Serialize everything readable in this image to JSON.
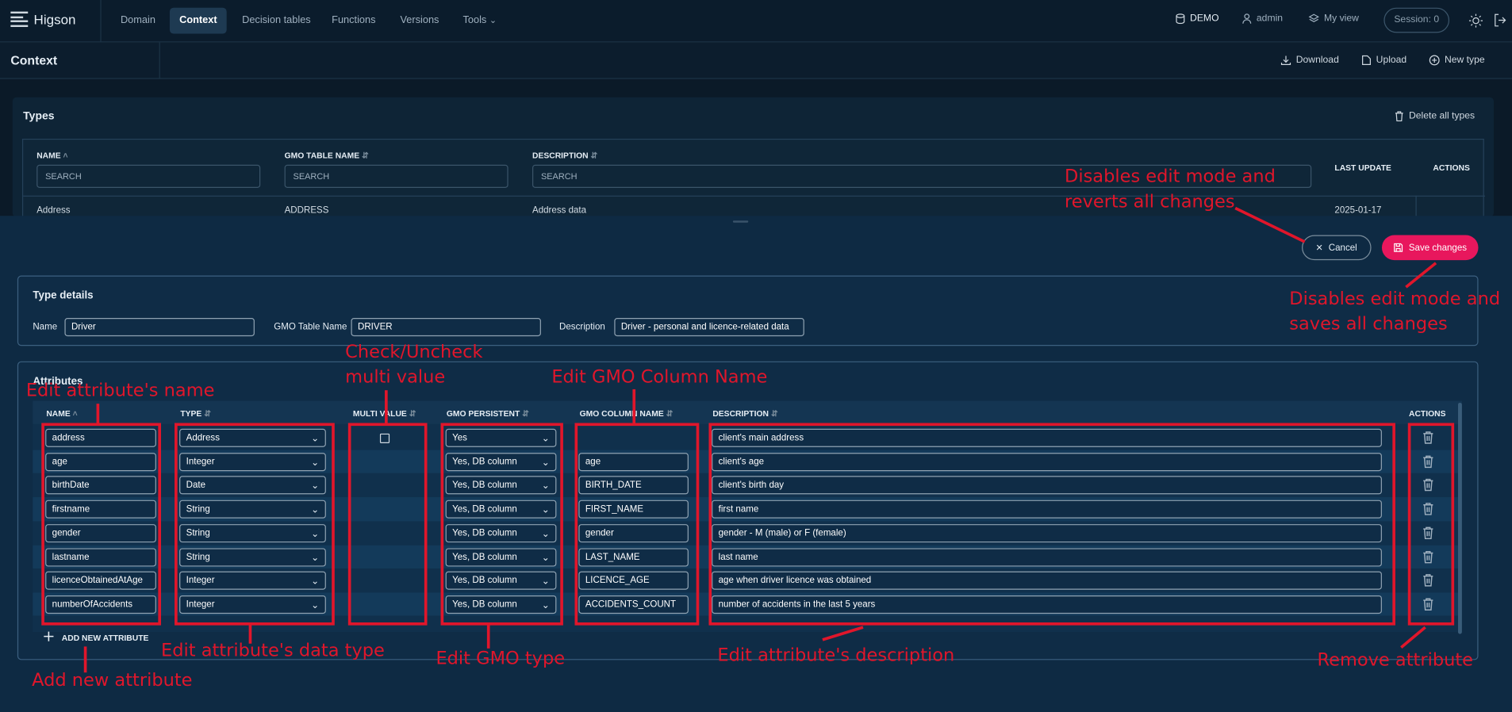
{
  "app": {
    "brand": "Higson"
  },
  "nav": {
    "items": [
      "Domain",
      "Context",
      "Decision tables",
      "Functions",
      "Versions",
      "Tools"
    ],
    "active": "Context"
  },
  "topright": {
    "env": "DEMO",
    "user": "admin",
    "view": "My view",
    "session": "Session: 0"
  },
  "subbar": {
    "title": "Context",
    "download": "Download",
    "upload": "Upload",
    "new_type": "New type"
  },
  "types": {
    "title": "Types",
    "delete_all": "Delete all types",
    "headers": {
      "name": "NAME",
      "gmo": "GMO TABLE NAME",
      "description": "DESCRIPTION",
      "last_update": "LAST UPDATE",
      "actions": "ACTIONS"
    },
    "search_placeholder": "SEARCH",
    "row": {
      "name": "Address",
      "gmo": "ADDRESS",
      "description": "Address data",
      "last_update": "2025-01-17"
    }
  },
  "actions": {
    "cancel": "Cancel",
    "save": "Save changes"
  },
  "type_details": {
    "title": "Type details",
    "name_label": "Name",
    "name_value": "Driver",
    "gmo_label": "GMO Table Name",
    "gmo_value": "DRIVER",
    "desc_label": "Description",
    "desc_value": "Driver - personal and licence-related data"
  },
  "attributes": {
    "title": "Attributes",
    "headers": {
      "name": "NAME",
      "type": "TYPE",
      "multi": "MULTI VALUE",
      "persistent": "GMO PERSISTENT",
      "column": "GMO COLUMN NAME",
      "description": "DESCRIPTION",
      "actions": "ACTIONS"
    },
    "rows": [
      {
        "name": "address",
        "type": "Address",
        "multi": true,
        "persistent": "Yes",
        "column": "",
        "description": "client's main address"
      },
      {
        "name": "age",
        "type": "Integer",
        "multi": false,
        "persistent": "Yes, DB column",
        "column": "age",
        "description": "client's age"
      },
      {
        "name": "birthDate",
        "type": "Date",
        "multi": false,
        "persistent": "Yes, DB column",
        "column": "BIRTH_DATE",
        "description": "client's birth day"
      },
      {
        "name": "firstname",
        "type": "String",
        "multi": false,
        "persistent": "Yes, DB column",
        "column": "FIRST_NAME",
        "description": "first name"
      },
      {
        "name": "gender",
        "type": "String",
        "multi": false,
        "persistent": "Yes, DB column",
        "column": "gender",
        "description": "gender - M (male) or F (female)"
      },
      {
        "name": "lastname",
        "type": "String",
        "multi": false,
        "persistent": "Yes, DB column",
        "column": "LAST_NAME",
        "description": "last name"
      },
      {
        "name": "licenceObtainedAtAge",
        "type": "Integer",
        "multi": false,
        "persistent": "Yes, DB column",
        "column": "LICENCE_AGE",
        "description": "age when driver licence was obtained"
      },
      {
        "name": "numberOfAccidents",
        "type": "Integer",
        "multi": false,
        "persistent": "Yes, DB column",
        "column": "ACCIDENTS_COUNT",
        "description": "number of accidents in the last 5 years"
      }
    ],
    "add_new": "ADD NEW ATTRIBUTE"
  },
  "annotations": {
    "cancel_1": "Disables edit mode and",
    "cancel_2": "reverts all changes",
    "save_1": "Disables edit mode and",
    "save_2": "saves all changes",
    "multi_1": "Check/Uncheck",
    "multi_2": "multi value",
    "column": "Edit GMO Column Name",
    "name": "Edit attribute's name",
    "type": "Edit attribute's data type",
    "gmo_type": "Edit GMO type",
    "description": "Edit attribute's description",
    "remove": "Remove attribute",
    "add": "Add new attribute"
  },
  "colors": {
    "accent": "#e8175d",
    "annotation": "#e0162b",
    "bg": "#0b1a28"
  }
}
